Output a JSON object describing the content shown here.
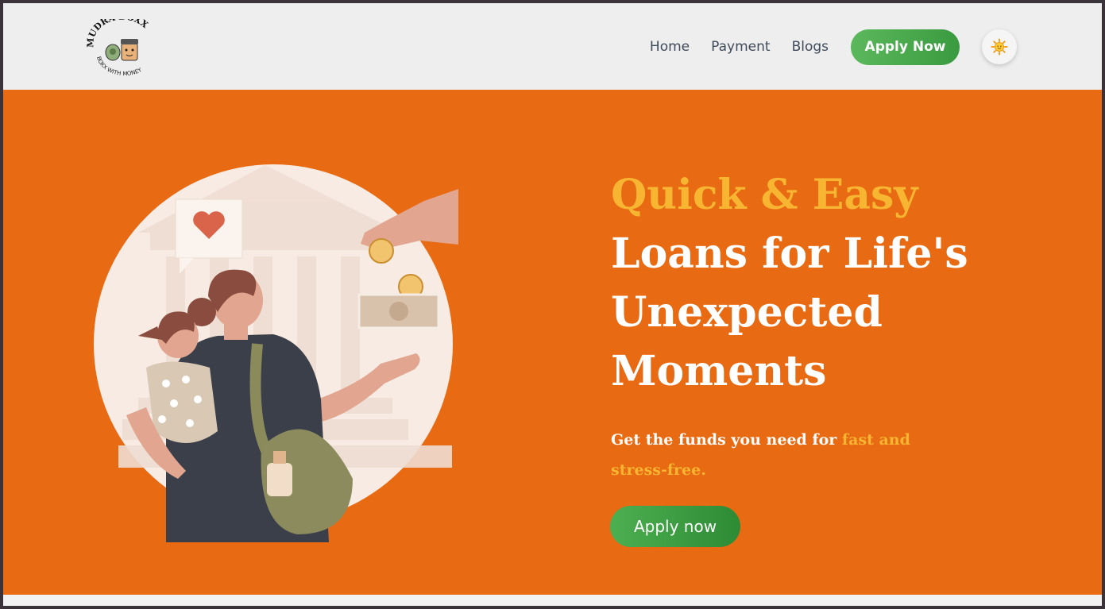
{
  "header": {
    "logo": {
      "brand": "MUDRA BOXX",
      "tagline": "BOXX WITH MONEY"
    },
    "nav": [
      {
        "label": "Home"
      },
      {
        "label": "Payment"
      },
      {
        "label": "Blogs"
      }
    ],
    "apply_label": "Apply Now",
    "theme_icon": "sun-icon"
  },
  "hero": {
    "headline_accent": "Quick & Easy",
    "headline_lines": [
      "Loans for Life's",
      "Unexpected",
      "Moments"
    ],
    "sub_text": "Get the funds you need for ",
    "sub_highlight": "fast and stress-free.",
    "cta_label": "Apply now"
  },
  "colors": {
    "hero_bg": "#e86a12",
    "accent_yellow": "#f7b531",
    "button_green": "#4caf50",
    "header_bg": "#eeeeee"
  }
}
